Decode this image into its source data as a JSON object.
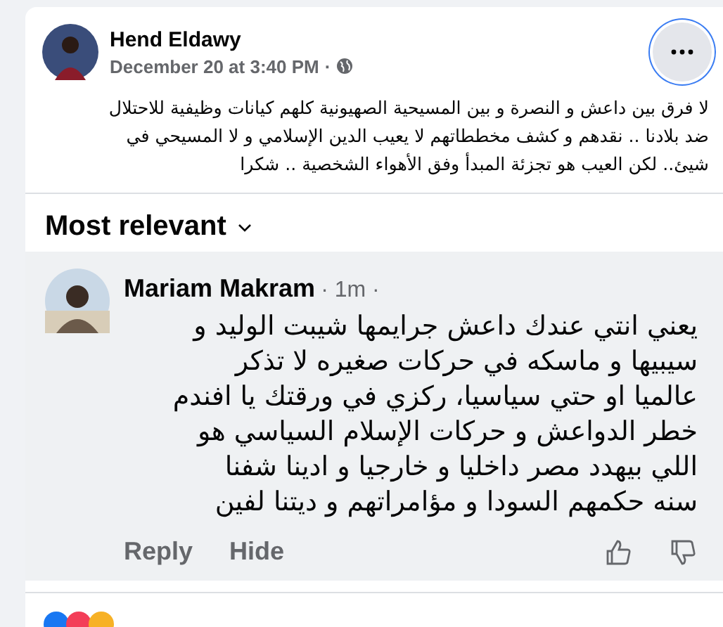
{
  "post": {
    "author": "Hend Eldawy",
    "time": "December 20 at 3:40 PM",
    "separator": "·",
    "text_lines": [
      "لا فرق بين داعش و النصرة و بين المسيحية الصهيونية كلهم كيانات وظيفية للاحتلال",
      "ضد بلادنا .. نقدهم و كشف مخططاتهم لا يعيب الدين الإسلامي و لا المسيحي في",
      "شيئ.. لكن العيب هو تجزئة المبدأ وفق الأهواء الشخصية .. شكرا"
    ],
    "menu_focused": true
  },
  "sort": {
    "label": "Most relevant"
  },
  "comment": {
    "author": "Mariam Makram",
    "meta": "· 1m ·",
    "text_lines": [
      "يعني انتي عندك داعش جرايمها شيبت الوليد و",
      "سيبيها و ماسكه في حركات صغيره لا تذكر",
      "عالميا او حتي سياسيا، ركزي في ورقتك يا افندم",
      "خطر الدواعش و حركات الإسلام السياسي هو",
      "اللي بيهدد مصر داخليا و خارجيا و ادينا شفنا",
      "سنه حكمهم السودا و مؤامراتهم و ديتنا لفين"
    ],
    "reply_action": "Reply",
    "hide_action": "Hide"
  }
}
